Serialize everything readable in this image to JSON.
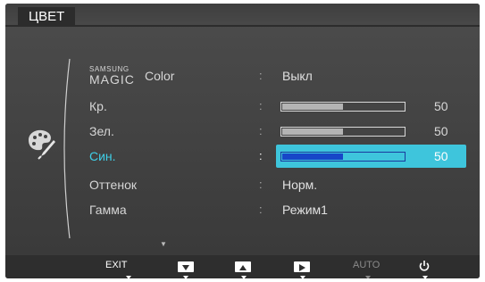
{
  "title": "ЦВЕТ",
  "menu": {
    "items": [
      {
        "id": "magic",
        "label_small": "SAMSUNG",
        "label_big": "MAGIC",
        "label_rest": "Color",
        "type": "text",
        "value": "Выкл"
      },
      {
        "id": "red",
        "label": "Кр.",
        "type": "slider",
        "value": 50
      },
      {
        "id": "green",
        "label": "Зел.",
        "type": "slider",
        "value": 50
      },
      {
        "id": "blue",
        "label": "Син.",
        "type": "slider",
        "value": 50,
        "selected": true
      },
      {
        "id": "tone",
        "label": "Оттенок",
        "type": "text",
        "value": "Норм."
      },
      {
        "id": "gamma",
        "label": "Гамма",
        "type": "text",
        "value": "Режим1"
      }
    ],
    "colon": ":",
    "more_arrow": "▼"
  },
  "buttons": {
    "exit": "EXIT",
    "down": "▼",
    "up": "▲",
    "enter": "▶",
    "auto": "AUTO",
    "power": "⏻"
  },
  "colors": {
    "highlight": "#3ec5dc",
    "selected_text": "#3fd0e8",
    "slider_fill_selected": "#1747c8"
  }
}
